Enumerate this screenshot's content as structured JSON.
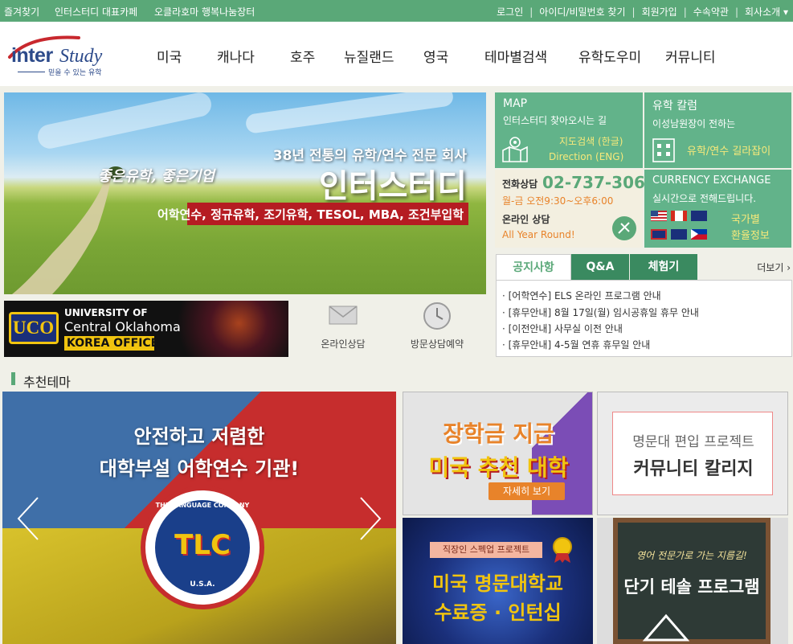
{
  "topbar": {
    "left_links": [
      "즐겨찾기",
      "인터스터디 대표카페",
      "오클라호마 행복나눔장터"
    ],
    "right_links": [
      "로그인",
      "아이디/비밀번호 찾기",
      "회원가입",
      "수속약관",
      "회사소개 ▾"
    ]
  },
  "logo": {
    "brand_left": "inter",
    "brand_right": "Study",
    "tagline": "믿을 수 있는 유학"
  },
  "nav": [
    "미국",
    "캐나다",
    "호주",
    "뉴질랜드",
    "영국",
    "테마별검색",
    "유학도우미",
    "커뮤니티"
  ],
  "hero": {
    "line1": "38년 전통의 유학/연수 전문 회사",
    "script": "좋은유학, 좋은기업",
    "name": "인터스터디",
    "programs": "어학연수, 정규유학, 조기유학, TESOL, MBA, 조건부입학"
  },
  "map_tile": {
    "title": "MAP",
    "subtitle": "인터스터디 찾아오시는 길",
    "link1": "지도검색 (한글)",
    "link2": "Direction (ENG)"
  },
  "column_tile": {
    "title": "유학 칼럼",
    "subtitle": "이성남원장이 전하는",
    "link": "유학/연수 길라잡이"
  },
  "contact_tile": {
    "phone_label": "전화상담",
    "phone": "02-737-3066",
    "hours": "월-금 오전9:30~오후6:00",
    "online_label": "온라인 상담",
    "online_hours": "All Year Round!"
  },
  "currency_tile": {
    "title": "CURRENCY EXCHANGE",
    "subtitle": "실시간으로 전해드립니다.",
    "link1": "국가별",
    "link2": "환율정보"
  },
  "tabs": {
    "items": [
      "공지사항",
      "Q&A",
      "체험기"
    ],
    "more": "더보기 ›",
    "notices": [
      "· [어학연수] ELS 온라인 프로그램 안내",
      "· [휴무안내] 8월 17일(월) 임시공휴일 휴무 안내",
      "· [이전안내] 사무실 이전 안내",
      "· [휴무안내] 4-5월 연휴 휴무일 안내"
    ]
  },
  "uco_banner": {
    "line1": "UNIVERSITY OF",
    "line2": "Central Oklahoma",
    "line3": "KOREA OFFICE",
    "logo": "UCO"
  },
  "quick_links": {
    "online": "온라인상담",
    "visit": "방문상담예약"
  },
  "section_title": "추천테마",
  "carousel": {
    "line1": "안전하고 저렴한",
    "line2": "대학부설 어학연수 기관!",
    "badge_top": "THE LANGUAGE COMPANY",
    "badge_bottom": "U.S.A.",
    "badge_letters": "TLC"
  },
  "promos": {
    "p1": {
      "line1": "장학금 지급",
      "line2": "미국 추천 대학",
      "button": "자세히 보기"
    },
    "p2": {
      "line1": "명문대 편입 프로젝트",
      "line2": "커뮤니티 칼리지"
    },
    "p3": {
      "tag": "직장인 스펙업 프로젝트",
      "line1": "미국 명문대학교",
      "line2": "수료증 · 인턴십"
    },
    "p4": {
      "line1": "영어 전문가로 가는 지름길!",
      "line2": "단기 테솔 프로그램"
    }
  },
  "colors": {
    "green": "#5aa878",
    "tile_green": "#62b38a",
    "beige": "#f3efe0",
    "orange": "#e8832a",
    "dark_tab": "#3a8a60"
  }
}
